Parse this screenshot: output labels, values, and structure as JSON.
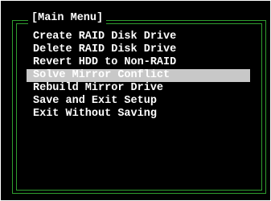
{
  "menu": {
    "title": "[Main Menu]",
    "selected_index": 3,
    "items": [
      {
        "label": "Create RAID Disk Drive"
      },
      {
        "label": "Delete RAID Disk Drive"
      },
      {
        "label": "Revert HDD to Non-RAID"
      },
      {
        "label": "Solve Mirror Conflict"
      },
      {
        "label": "Rebuild Mirror Drive"
      },
      {
        "label": "Save and Exit Setup"
      },
      {
        "label": "Exit Without Saving"
      }
    ]
  },
  "colors": {
    "background": "#000000",
    "border": "#2f9e2f",
    "text": "#ffffff",
    "highlight": "#c8c8c8"
  }
}
